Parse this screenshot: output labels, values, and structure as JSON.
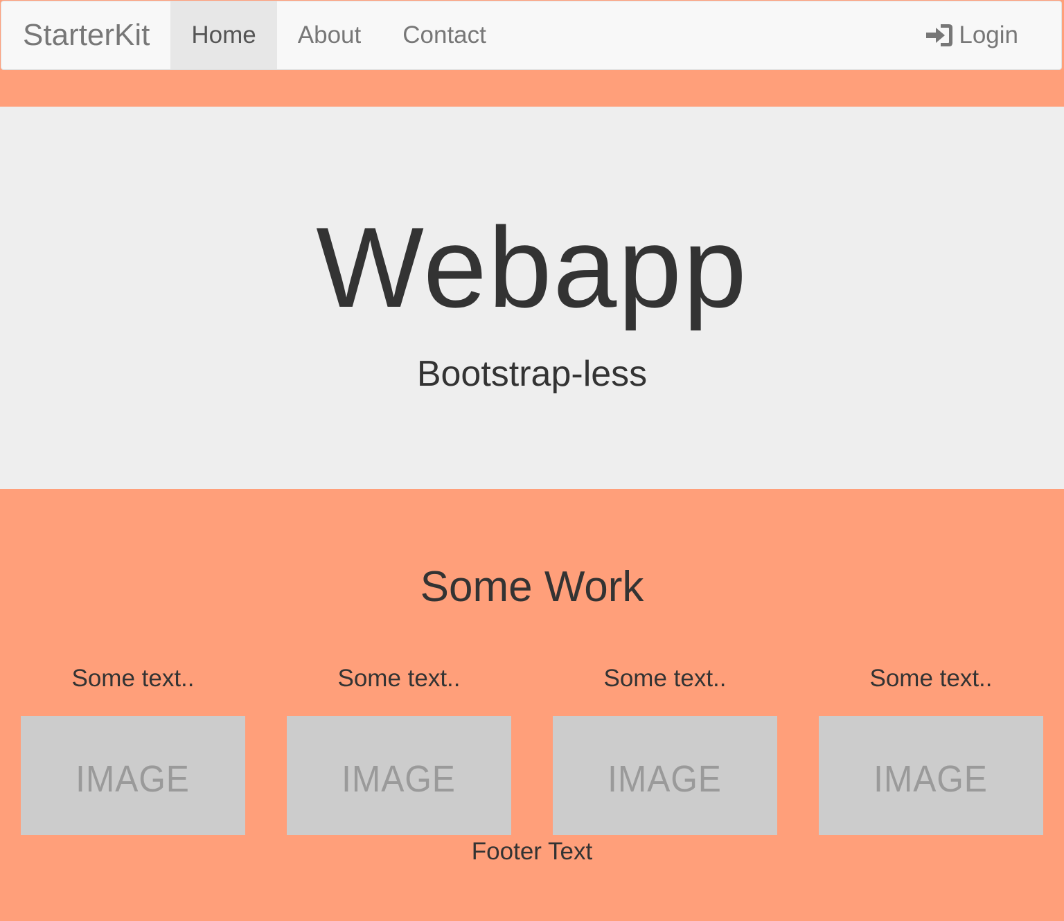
{
  "navbar": {
    "brand": "StarterKit",
    "items": [
      {
        "label": "Home"
      },
      {
        "label": "About"
      },
      {
        "label": "Contact"
      }
    ],
    "login_label": "Login",
    "login_icon": "sign-in-icon"
  },
  "hero": {
    "title": "Webapp",
    "subtitle": "Bootstrap-less"
  },
  "work": {
    "title": "Some Work",
    "cards": [
      {
        "text": "Some text..",
        "image_label": "IMAGE"
      },
      {
        "text": "Some text..",
        "image_label": "IMAGE"
      },
      {
        "text": "Some text..",
        "image_label": "IMAGE"
      },
      {
        "text": "Some text..",
        "image_label": "IMAGE"
      }
    ]
  },
  "footer": {
    "text": "Footer Text"
  },
  "colors": {
    "page_background": "#ff9f7a",
    "hero_background": "#eeeeee",
    "navbar_background": "#f8f8f8",
    "active_nav_background": "#e7e7e7",
    "image_placeholder": "#cccccc"
  }
}
